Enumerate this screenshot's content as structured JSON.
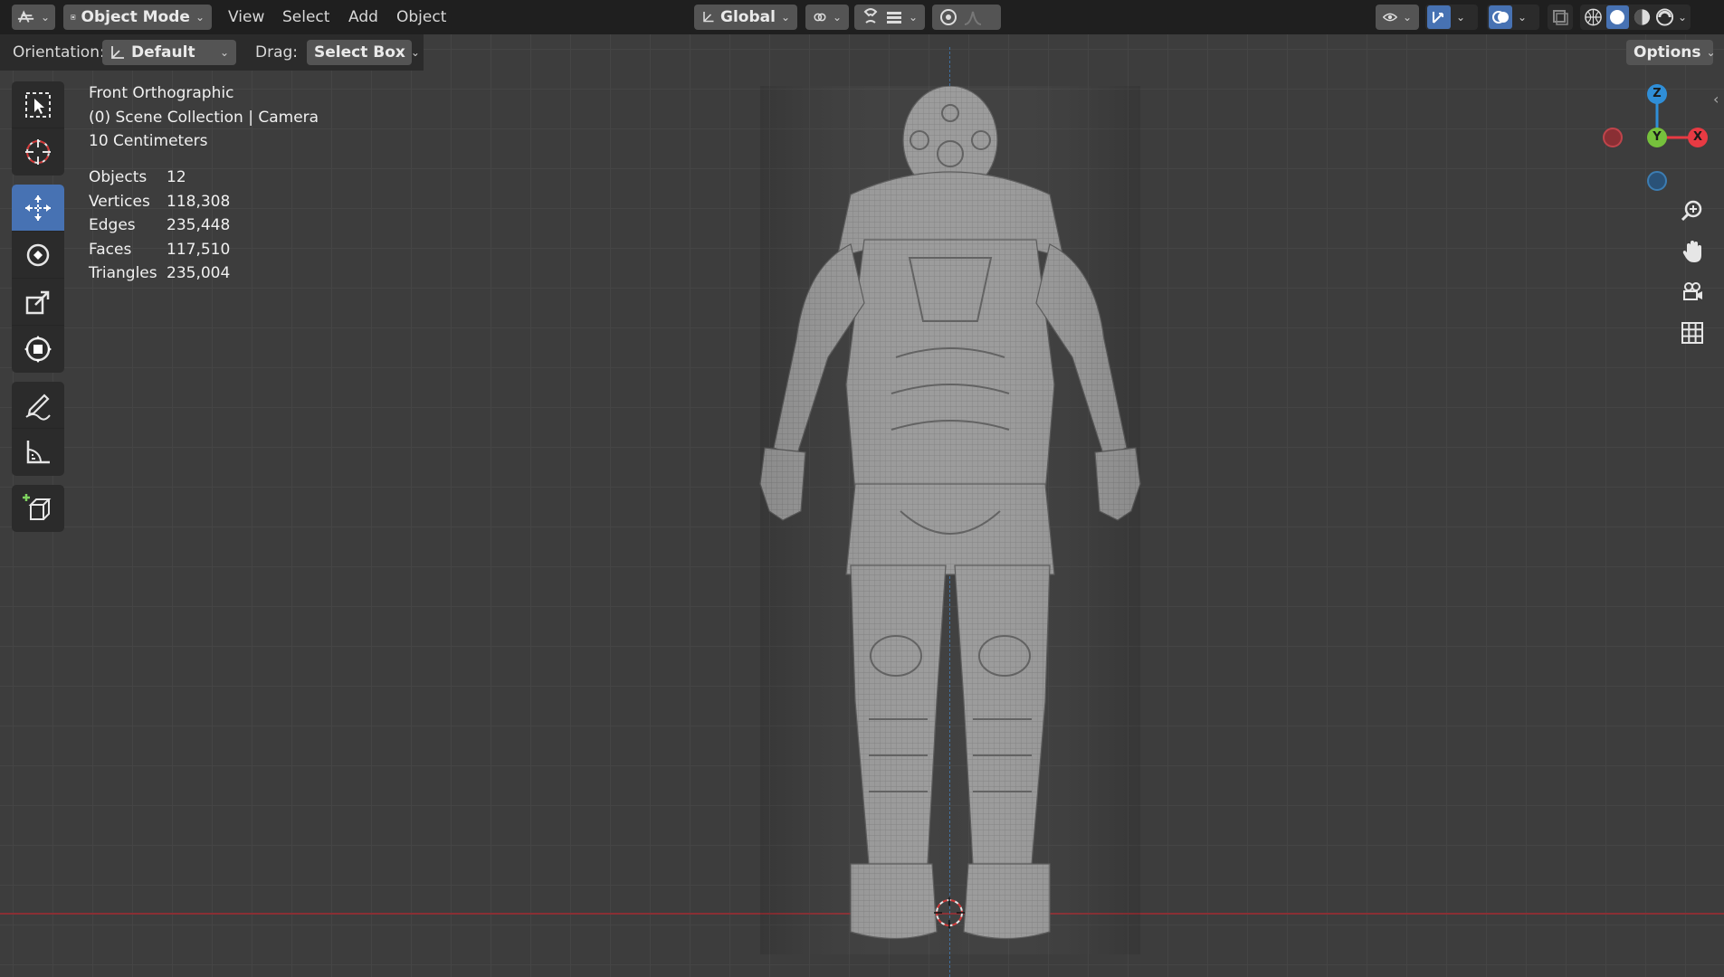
{
  "header": {
    "mode_label": "Object Mode",
    "menus": [
      "View",
      "Select",
      "Add",
      "Object"
    ],
    "transform_orientation": "Global",
    "options_label": "Options"
  },
  "tool_header": {
    "orientation_label": "Orientation:",
    "orientation_value": "Default",
    "drag_label": "Drag:",
    "drag_value": "Select Box"
  },
  "viewport": {
    "view_name": "Front Orthographic",
    "collection_line": "(0) Scene Collection | Camera",
    "scale_line": "10 Centimeters",
    "stats": [
      {
        "label": "Objects",
        "value": "12"
      },
      {
        "label": "Vertices",
        "value": "118,308"
      },
      {
        "label": "Edges",
        "value": "235,448"
      },
      {
        "label": "Faces",
        "value": "117,510"
      },
      {
        "label": "Triangles",
        "value": "235,004"
      }
    ]
  },
  "gizmo": {
    "z": "Z",
    "y": "Y",
    "x": "X"
  },
  "toolbar_icons": [
    "select-box-icon",
    "cursor-icon",
    "move-icon",
    "rotate-icon",
    "scale-icon",
    "transform-icon",
    "annotate-icon",
    "measure-icon",
    "add-cube-icon"
  ],
  "colors": {
    "accent": "#4772b3",
    "x_axis": "#e83a43",
    "y_axis": "#76c13c",
    "z_axis": "#2f8ed7",
    "mesh": "#9c9c9c"
  }
}
